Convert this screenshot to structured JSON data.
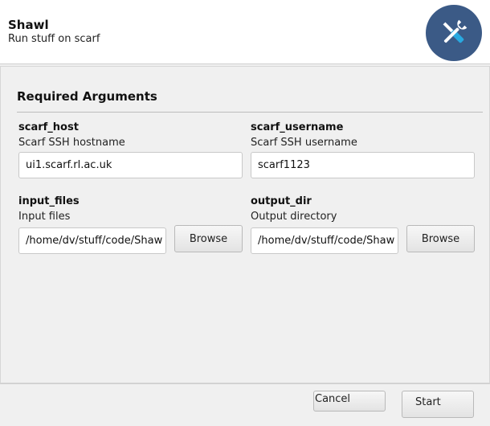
{
  "header": {
    "title": "Shawl",
    "subtitle": "Run stuff on scarf",
    "logo_icon": "tools-icon",
    "logo_color": "#3b5a86"
  },
  "section": {
    "title": "Required Arguments"
  },
  "fields": {
    "scarf_host": {
      "name": "scarf_host",
      "help": "Scarf SSH hostname",
      "value": "ui1.scarf.rl.ac.uk"
    },
    "scarf_username": {
      "name": "scarf_username",
      "help": "Scarf SSH username",
      "value": "scarf1123"
    },
    "input_files": {
      "name": "input_files",
      "help": "Input files",
      "value": "/home/dv/stuff/code/Shaw",
      "browse_label": "Browse"
    },
    "output_dir": {
      "name": "output_dir",
      "help": "Output directory",
      "value": "/home/dv/stuff/code/Shaw",
      "browse_label": "Browse"
    }
  },
  "footer": {
    "cancel_label": "Cancel",
    "start_label": "Start"
  }
}
